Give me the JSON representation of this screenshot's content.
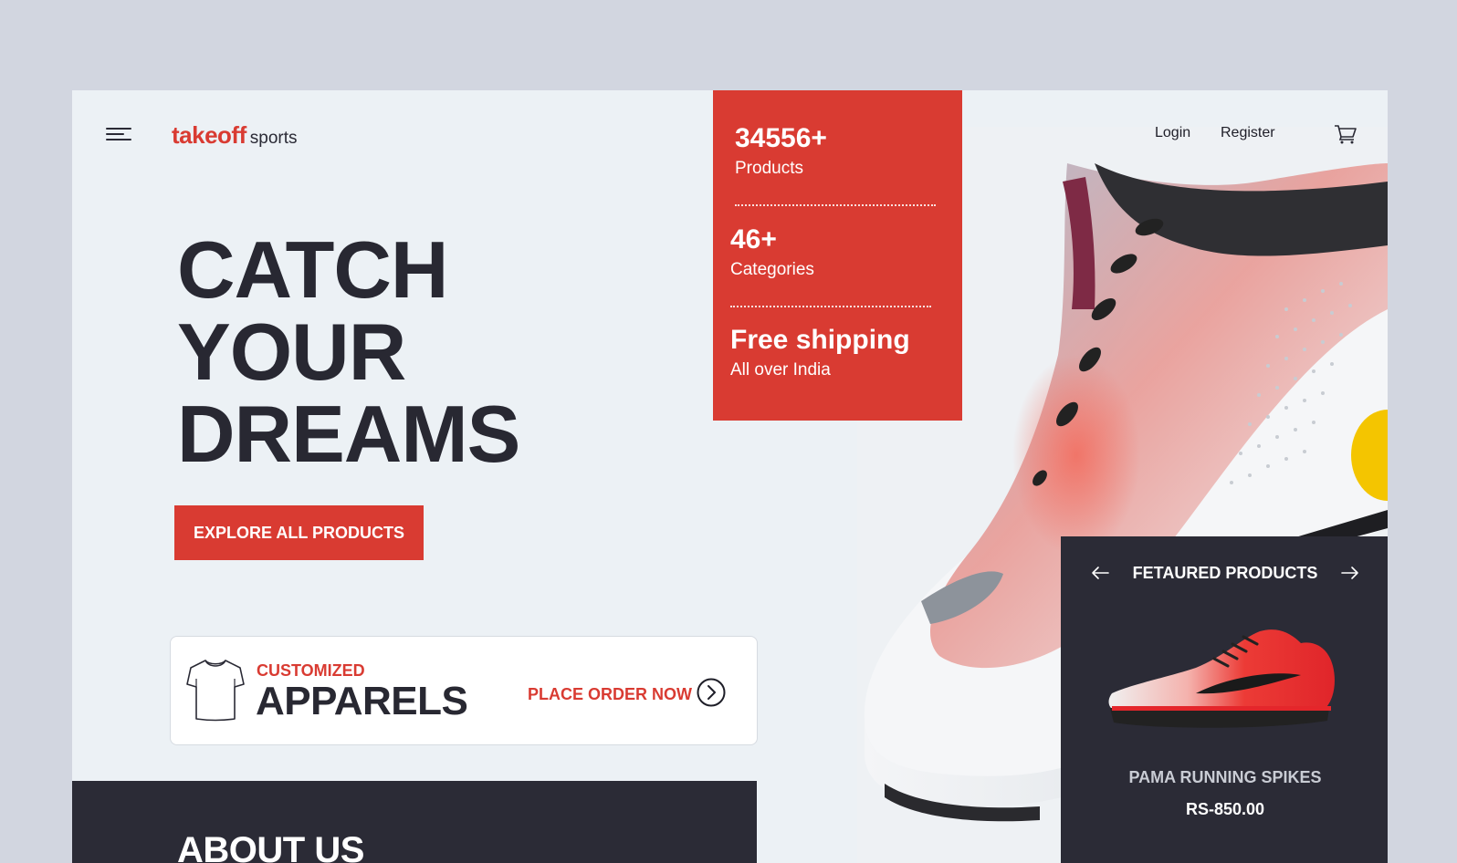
{
  "header": {
    "logo_brand": "takeoff",
    "logo_sub": "sports",
    "login": "Login",
    "register": "Register"
  },
  "hero": {
    "title_line1": "CATCH YOUR",
    "title_line2": "DREAMS",
    "cta": "EXPLORE ALL PRODUCTS"
  },
  "stats": [
    {
      "value": "34556+",
      "label": "Products"
    },
    {
      "value": "46+",
      "label": "Categories"
    },
    {
      "value": "Free shipping",
      "label": "All over India"
    }
  ],
  "apparel": {
    "kicker": "CUSTOMIZED",
    "title": "APPARELS",
    "cta": "PLACE ORDER NOW"
  },
  "about": {
    "title": "ABOUT US"
  },
  "featured": {
    "title": "FETAURED PRODUCTS",
    "product_name": "PAMA RUNNING SPIKES",
    "price": "RS-850.00"
  },
  "colors": {
    "accent": "#d93b32",
    "dark": "#2b2b36",
    "background": "#ecf1f5",
    "outer": "#d2d6e0"
  },
  "icons": [
    "menu-icon",
    "cart-icon",
    "tshirt-icon",
    "chevron-right-circle-icon",
    "arrow-left-icon",
    "arrow-right-icon"
  ]
}
